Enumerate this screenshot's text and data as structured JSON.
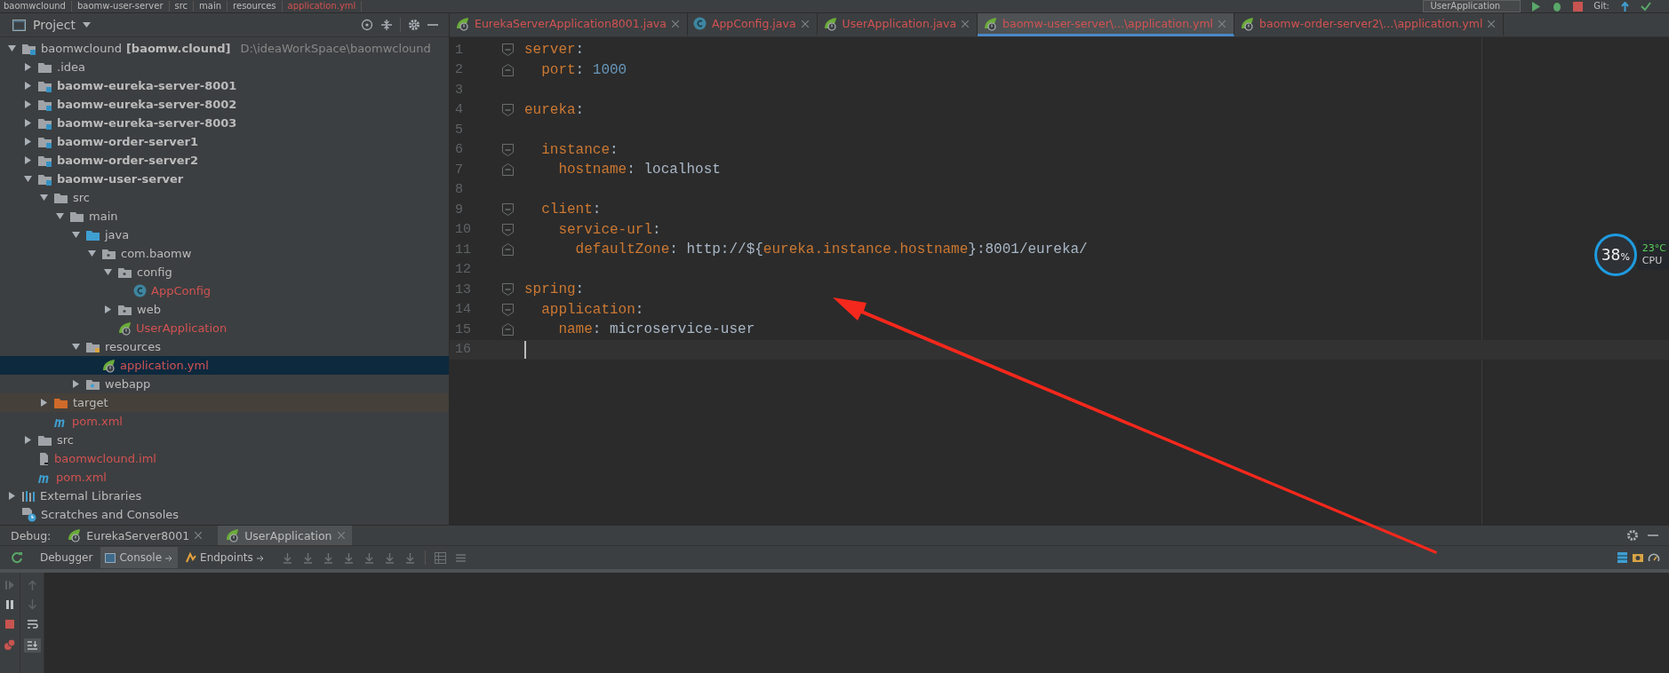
{
  "breadcrumb": [
    {
      "text": "baomwclound",
      "kind": "module"
    },
    {
      "text": "baomw-user-server",
      "kind": "module"
    },
    {
      "text": "src",
      "kind": "folder"
    },
    {
      "text": "main",
      "kind": "folder"
    },
    {
      "text": "resources",
      "kind": "resources"
    },
    {
      "text": "application.yml",
      "kind": "yml"
    }
  ],
  "toolbar": {
    "run_config": "UserApplication",
    "vcs_label": "Git:"
  },
  "project_panel": {
    "title": "Project"
  },
  "tree": [
    {
      "name": "baomwclound",
      "qualifier": "[baomw.clound]",
      "path": "D:\\ideaWorkSpace\\baomwclound",
      "kind": "module",
      "expanded": true,
      "selected": false,
      "changed": false,
      "children": [
        {
          "name": ".idea",
          "kind": "folder",
          "expanded": false,
          "selected": false,
          "changed": false
        },
        {
          "name": "baomw-eureka-server-8001",
          "kind": "module",
          "expanded": false,
          "selected": false,
          "changed": false
        },
        {
          "name": "baomw-eureka-server-8002",
          "kind": "module",
          "expanded": false,
          "selected": false,
          "changed": false
        },
        {
          "name": "baomw-eureka-server-8003",
          "kind": "module",
          "expanded": false,
          "selected": false,
          "changed": false
        },
        {
          "name": "baomw-order-server1",
          "kind": "module",
          "expanded": false,
          "selected": false,
          "changed": false
        },
        {
          "name": "baomw-order-server2",
          "kind": "module",
          "expanded": false,
          "selected": false,
          "changed": false
        },
        {
          "name": "baomw-user-server",
          "kind": "module",
          "expanded": true,
          "selected": false,
          "changed": false,
          "children": [
            {
              "name": "src",
              "kind": "folder",
              "expanded": true,
              "selected": false,
              "changed": false,
              "children": [
                {
                  "name": "main",
                  "kind": "folder",
                  "expanded": true,
                  "selected": false,
                  "changed": false,
                  "children": [
                    {
                      "name": "java",
                      "kind": "source-folder",
                      "expanded": true,
                      "selected": false,
                      "changed": false,
                      "children": [
                        {
                          "name": "com.baomw",
                          "kind": "package",
                          "expanded": true,
                          "selected": false,
                          "changed": false,
                          "children": [
                            {
                              "name": "config",
                              "kind": "package",
                              "expanded": true,
                              "selected": false,
                              "changed": false,
                              "children": [
                                {
                                  "name": "AppConfig",
                                  "kind": "class",
                                  "selected": false,
                                  "changed": true
                                }
                              ]
                            },
                            {
                              "name": "web",
                              "kind": "package",
                              "expanded": false,
                              "selected": false,
                              "changed": false
                            },
                            {
                              "name": "UserApplication",
                              "kind": "spring-app",
                              "selected": false,
                              "changed": true
                            }
                          ]
                        }
                      ]
                    },
                    {
                      "name": "resources",
                      "kind": "resources",
                      "expanded": true,
                      "selected": false,
                      "changed": false,
                      "children": [
                        {
                          "name": "application.yml",
                          "kind": "yml",
                          "selected": true,
                          "changed": true
                        }
                      ]
                    },
                    {
                      "name": "webapp",
                      "kind": "web-folder",
                      "expanded": false,
                      "selected": false,
                      "changed": false
                    }
                  ]
                }
              ]
            },
            {
              "name": "target",
              "kind": "excluded-folder",
              "expanded": false,
              "selected": false,
              "changed": false
            },
            {
              "name": "pom.xml",
              "kind": "maven",
              "selected": false,
              "changed": true
            }
          ]
        },
        {
          "name": "src",
          "kind": "folder",
          "expanded": false,
          "selected": false,
          "changed": false
        },
        {
          "name": "baomwclound.iml",
          "kind": "iml",
          "selected": false,
          "changed": true
        },
        {
          "name": "pom.xml",
          "kind": "maven",
          "selected": false,
          "changed": true
        }
      ]
    },
    {
      "name": "External Libraries",
      "kind": "libraries",
      "expanded": false,
      "selected": false,
      "changed": false
    },
    {
      "name": "Scratches and Consoles",
      "kind": "scratches",
      "selected": false,
      "changed": false
    }
  ],
  "editor_tabs": [
    {
      "label": "EurekaServerApplication8001.java",
      "kind": "spring-app",
      "selected": false
    },
    {
      "label": "AppConfig.java",
      "kind": "class",
      "selected": false
    },
    {
      "label": "UserApplication.java",
      "kind": "spring-app",
      "selected": false
    },
    {
      "label": "baomw-user-server\\...\\application.yml",
      "kind": "yml",
      "selected": true
    },
    {
      "label": "baomw-order-server2\\...\\application.yml",
      "kind": "yml",
      "selected": false
    }
  ],
  "code": [
    {
      "number": "1",
      "kind": "fold-start",
      "current": false,
      "tokens": [
        {
          "kind": "key",
          "text": "server"
        },
        {
          "kind": "punct",
          "text": ":"
        }
      ]
    },
    {
      "number": "2",
      "kind": "fold-end",
      "current": false,
      "tokens": [
        {
          "kind": "key",
          "text": "  port"
        },
        {
          "kind": "punct",
          "text": ": "
        },
        {
          "kind": "number",
          "text": "1000"
        }
      ]
    },
    {
      "number": "3",
      "kind": "plain",
      "current": false
    },
    {
      "number": "4",
      "kind": "fold-start",
      "current": false,
      "tokens": [
        {
          "kind": "key",
          "text": "eureka"
        },
        {
          "kind": "punct",
          "text": ":"
        }
      ]
    },
    {
      "number": "5",
      "kind": "plain",
      "current": false
    },
    {
      "number": "6",
      "kind": "fold-start",
      "current": false,
      "tokens": [
        {
          "kind": "key",
          "text": "  instance"
        },
        {
          "kind": "punct",
          "text": ":"
        }
      ]
    },
    {
      "number": "7",
      "kind": "fold-end",
      "current": false,
      "tokens": [
        {
          "kind": "key",
          "text": "    hostname"
        },
        {
          "kind": "punct",
          "text": ": "
        },
        {
          "kind": "text",
          "text": "localhost"
        }
      ]
    },
    {
      "number": "8",
      "kind": "plain",
      "current": false
    },
    {
      "number": "9",
      "kind": "fold-start",
      "current": false,
      "tokens": [
        {
          "kind": "key",
          "text": "  client"
        },
        {
          "kind": "punct",
          "text": ":"
        }
      ]
    },
    {
      "number": "10",
      "kind": "fold-start",
      "current": false,
      "tokens": [
        {
          "kind": "key",
          "text": "    service-url"
        },
        {
          "kind": "punct",
          "text": ":"
        }
      ]
    },
    {
      "number": "11",
      "kind": "fold-end",
      "current": false,
      "tokens": [
        {
          "kind": "key",
          "text": "      defaultZone"
        },
        {
          "kind": "punct",
          "text": ": "
        },
        {
          "kind": "text",
          "text": "http://${"
        },
        {
          "kind": "key",
          "text": "eureka.instance.hostname"
        },
        {
          "kind": "text",
          "text": "}:8001/eureka/"
        }
      ]
    },
    {
      "number": "12",
      "kind": "plain",
      "current": false
    },
    {
      "number": "13",
      "kind": "fold-start",
      "current": false,
      "tokens": [
        {
          "kind": "key",
          "text": "spring"
        },
        {
          "kind": "punct",
          "text": ":"
        }
      ]
    },
    {
      "number": "14",
      "kind": "fold-start",
      "current": false,
      "tokens": [
        {
          "kind": "key",
          "text": "  application"
        },
        {
          "kind": "punct",
          "text": ":"
        }
      ]
    },
    {
      "number": "15",
      "kind": "fold-end",
      "current": false,
      "tokens": [
        {
          "kind": "key",
          "text": "    name"
        },
        {
          "kind": "punct",
          "text": ": "
        },
        {
          "kind": "text",
          "text": "microservice-user"
        }
      ]
    },
    {
      "number": "16",
      "kind": "plain",
      "current": true
    }
  ],
  "cpu_widget": {
    "load": "38",
    "unit": "%",
    "temperature": "23°C",
    "label": "CPU"
  },
  "debug": {
    "title": "Debug:",
    "sessions": [
      {
        "label": "EurekaServer8001",
        "selected": false
      },
      {
        "label": "UserApplication",
        "selected": true
      }
    ],
    "tabs": [
      {
        "label": "Debugger",
        "kind": "plain",
        "selected": false
      },
      {
        "label": "Console",
        "kind": "console",
        "selected": true
      },
      {
        "label": "Endpoints",
        "kind": "endpoints",
        "selected": false
      }
    ]
  }
}
